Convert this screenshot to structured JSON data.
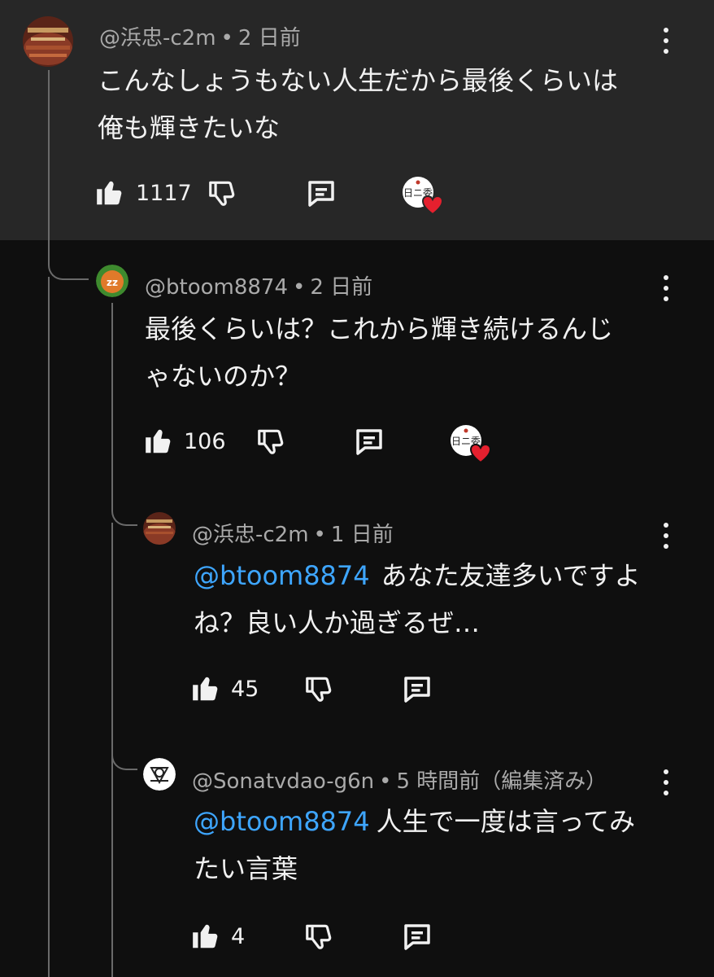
{
  "comments": [
    {
      "author": "@浜忠-c2m",
      "time": "2 日前",
      "lines": [
        "こんなしょうもない人生だから最後くらいは",
        "俺も輝きたいな"
      ],
      "likes": "1117",
      "hearted": true
    },
    {
      "author": "@btoom8874",
      "time": "2 日前",
      "lines": [
        "最後くらいは？これから輝き続けるんじ",
        "ゃないのか？"
      ],
      "likes": "106",
      "hearted": true
    },
    {
      "author": "@浜忠-c2m",
      "time": "1 日前",
      "mention": "@btoom8874",
      "lines": [
        "あなた友達多いですよ",
        "ね？良い人か過ぎるぜ…"
      ],
      "likes": "45",
      "hearted": false
    },
    {
      "author": "@Sonatvdao-g6n",
      "time": "5 時間前（編集済み）",
      "mention": "@btoom8874",
      "lines": [
        "人生で一度は言ってみ",
        "たい言葉"
      ],
      "likes": "4",
      "hearted": false
    }
  ],
  "heart_badge_text": "日ニ委",
  "icons": {
    "like": "thumbs-up-icon",
    "dislike": "thumbs-down-icon",
    "reply": "reply-comment-icon",
    "more": "more-vertical-icon",
    "heart": "creator-heart-icon"
  },
  "colors": {
    "background": "#0f0f0f",
    "highlight": "#272727",
    "text": "#f1f1f1",
    "meta": "#aaaaaa",
    "mention": "#3ea6ff",
    "heart": "#e5202e"
  }
}
